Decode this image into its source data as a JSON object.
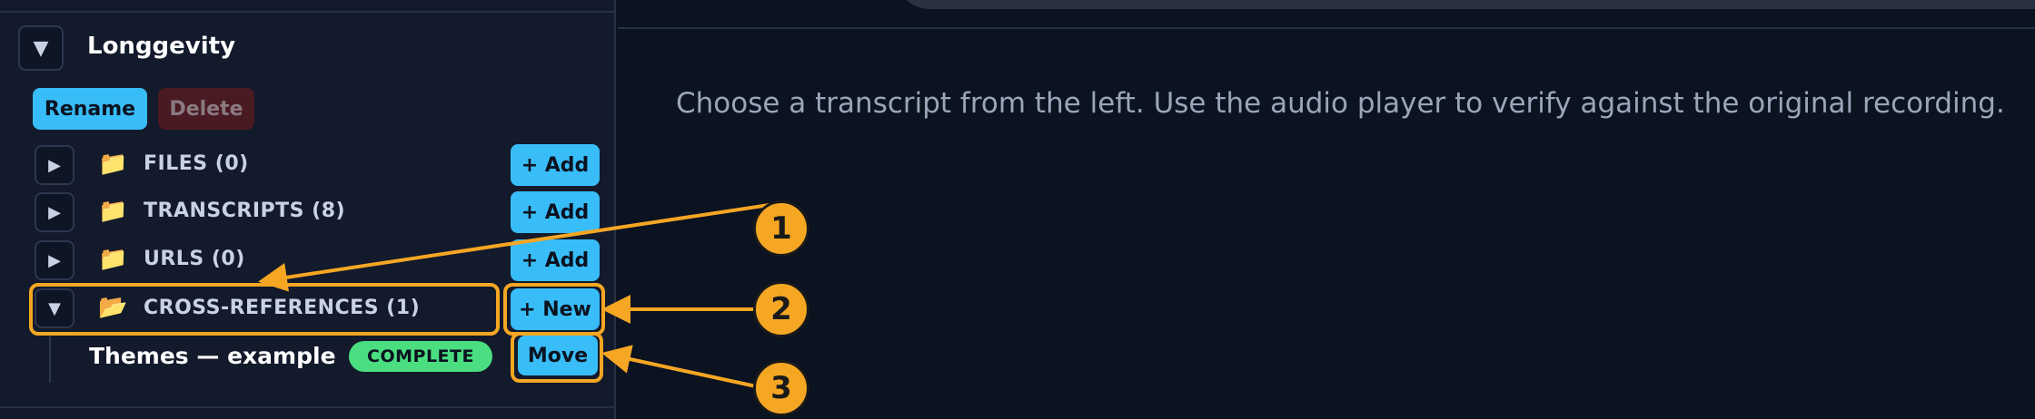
{
  "sidebar": {
    "collapse_icon": "▼",
    "project_name": "Longgevity",
    "rename_label": "Rename",
    "delete_label": "Delete",
    "folders": [
      {
        "label": "FILES (0)",
        "toggle": "▶",
        "icon": "📁",
        "action": "+ Add"
      },
      {
        "label": "TRANSCRIPTS (8)",
        "toggle": "▶",
        "icon": "📁",
        "action": "+ Add"
      },
      {
        "label": "URLS (0)",
        "toggle": "▶",
        "icon": "📁",
        "action": "+ Add"
      },
      {
        "label": "CROSS-REFERENCES (1)",
        "toggle": "▼",
        "icon": "📂",
        "action": "+ New"
      }
    ],
    "item": {
      "label": "Themes — example",
      "status": "COMPLETE",
      "move_label": "Move"
    }
  },
  "main": {
    "hint": "Choose a transcript from the left. Use the audio player to verify against the original recording."
  },
  "callouts": [
    "1",
    "2",
    "3"
  ],
  "colors": {
    "accent": "#38bdf8",
    "danger": "#4a1a22",
    "success": "#4ade80",
    "annotation": "#f5a623"
  }
}
